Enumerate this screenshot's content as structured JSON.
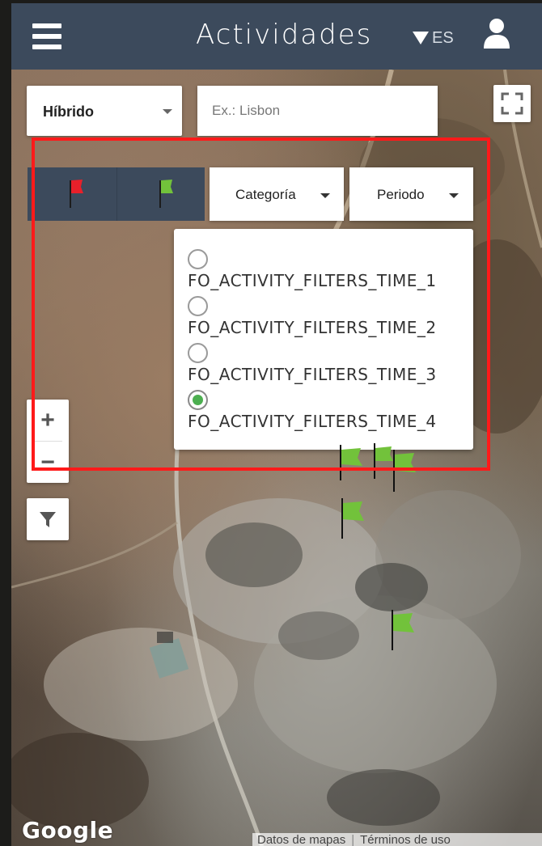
{
  "header": {
    "title": "Actividades",
    "language": "ES",
    "menu_icon": "hamburger-menu-icon",
    "user_icon": "user-icon"
  },
  "map": {
    "type_selector": {
      "label": "Híbrido"
    },
    "search": {
      "placeholder": "Ex.: Lisbon",
      "value": ""
    },
    "fullscreen_icon": "fullscreen-icon",
    "zoom_in_label": "+",
    "zoom_out_label": "−",
    "filter_icon": "funnel-icon",
    "google_logo": "Google",
    "attribution": {
      "map_data": "Datos de mapas",
      "terms": "Términos de uso"
    }
  },
  "filters": {
    "flags": [
      {
        "name": "red-flag",
        "color": "#e8202a"
      },
      {
        "name": "green-flag",
        "color": "#72c23b"
      }
    ],
    "category_label": "Categoría",
    "period_label": "Periodo",
    "period_options": [
      {
        "label": "FO_ACTIVITY_FILTERS_TIME_1",
        "selected": false
      },
      {
        "label": "FO_ACTIVITY_FILTERS_TIME_2",
        "selected": false
      },
      {
        "label": "FO_ACTIVITY_FILTERS_TIME_3",
        "selected": false
      },
      {
        "label": "FO_ACTIVITY_FILTERS_TIME_4",
        "selected": true
      }
    ]
  },
  "colors": {
    "header_bg": "#3c4a5c",
    "highlight": "#ff1a1a",
    "selected_radio": "#4caf50",
    "map_flag": "#72c23b"
  }
}
